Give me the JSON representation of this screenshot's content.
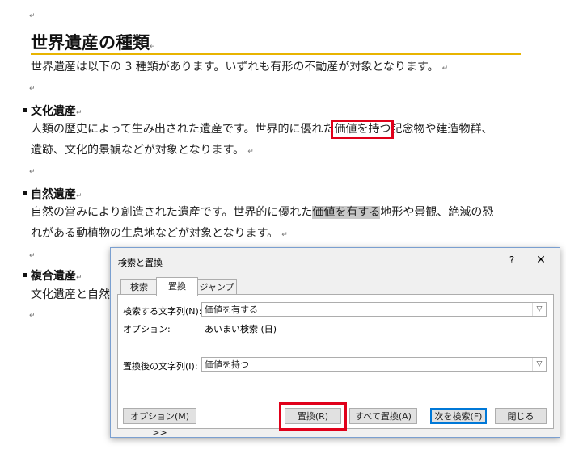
{
  "document": {
    "title": "世界遺産の種類",
    "intro": "世界遺産は以下の 3 種類があります。いずれも有形の不動産が対象となります。",
    "paragraph_mark": "↵",
    "sections": [
      {
        "heading": "文化遺産",
        "line1_before": "人類の歴史によって生み出された遺産です。世界的に優れた",
        "line1_highlight": "価値を持つ",
        "line1_after": "記念物や建造物群、",
        "line2": "遺跡、文化的景観などが対象となります。"
      },
      {
        "heading": "自然遺産",
        "line1_before": "自然の営みにより創造された遺産です。世界的に優れた",
        "line1_highlight": "価値を有する",
        "line1_after": "地形や景観、絶滅の恐",
        "line2": "れがある動植物の生息地などが対象となります。"
      },
      {
        "heading": "複合遺産",
        "line1_visible": "文化遺産と自然"
      }
    ]
  },
  "dialog": {
    "title": "検索と置換",
    "help_label": "?",
    "close_label": "✕",
    "tabs": [
      "検索",
      "置換",
      "ジャンプ"
    ],
    "active_tab": "置換",
    "find_label": "検索する文字列(N):",
    "find_value": "価値を有する",
    "options_label": "オプション:",
    "options_value": "あいまい検索 (日)",
    "replace_label": "置換後の文字列(I):",
    "replace_value": "価値を持つ",
    "buttons": {
      "options": "オプション(M) >>",
      "replace": "置換(R)",
      "replace_all": "すべて置換(A)",
      "find_next": "次を検索(F)",
      "close": "閉じる"
    }
  },
  "colors": {
    "title_rule": "#e8b400",
    "highlight_outline": "#e0001a",
    "selection_gray": "#c8c8c8",
    "dialog_border": "#7a9fd0"
  }
}
